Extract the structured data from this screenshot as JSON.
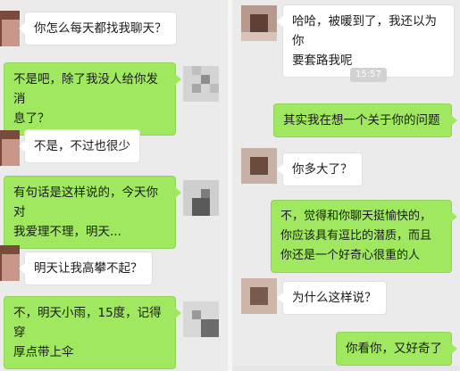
{
  "left_chat": {
    "messages": [
      {
        "side": "received",
        "text": "你怎么每天都找我聊天？"
      },
      {
        "side": "sent",
        "text": "不是吧，除了我没人给你发消\n息了？"
      },
      {
        "side": "received",
        "text": "不是，不过也很少"
      },
      {
        "side": "sent",
        "text": "有句话是这样说的，今天你对\n我爱理不理，明天..."
      },
      {
        "side": "received",
        "text": "明天让我高攀不起？"
      },
      {
        "side": "sent",
        "text": "不，明天小雨，15度，记得穿\n厚点带上伞"
      }
    ]
  },
  "right_chat": {
    "timestamp": "15:57",
    "messages": [
      {
        "side": "received",
        "text": "哈哈，被暖到了，我还以为你\n要套路我呢"
      },
      {
        "side": "sent",
        "text": "其实我在想一个关于你的问题"
      },
      {
        "side": "received",
        "text": "你多大了？"
      },
      {
        "side": "sent",
        "text": "不，觉得和你聊天挺愉快的，\n你应该具有逗比的潜质，而且\n你还是一个好奇心很重的人"
      },
      {
        "side": "received",
        "text": "为什么这样说？"
      },
      {
        "side": "sent",
        "text": "你看你，又好奇了"
      }
    ]
  },
  "colors": {
    "background": "#ebebeb",
    "sent_bubble": "#9fe85f",
    "received_bubble": "#ffffff"
  }
}
